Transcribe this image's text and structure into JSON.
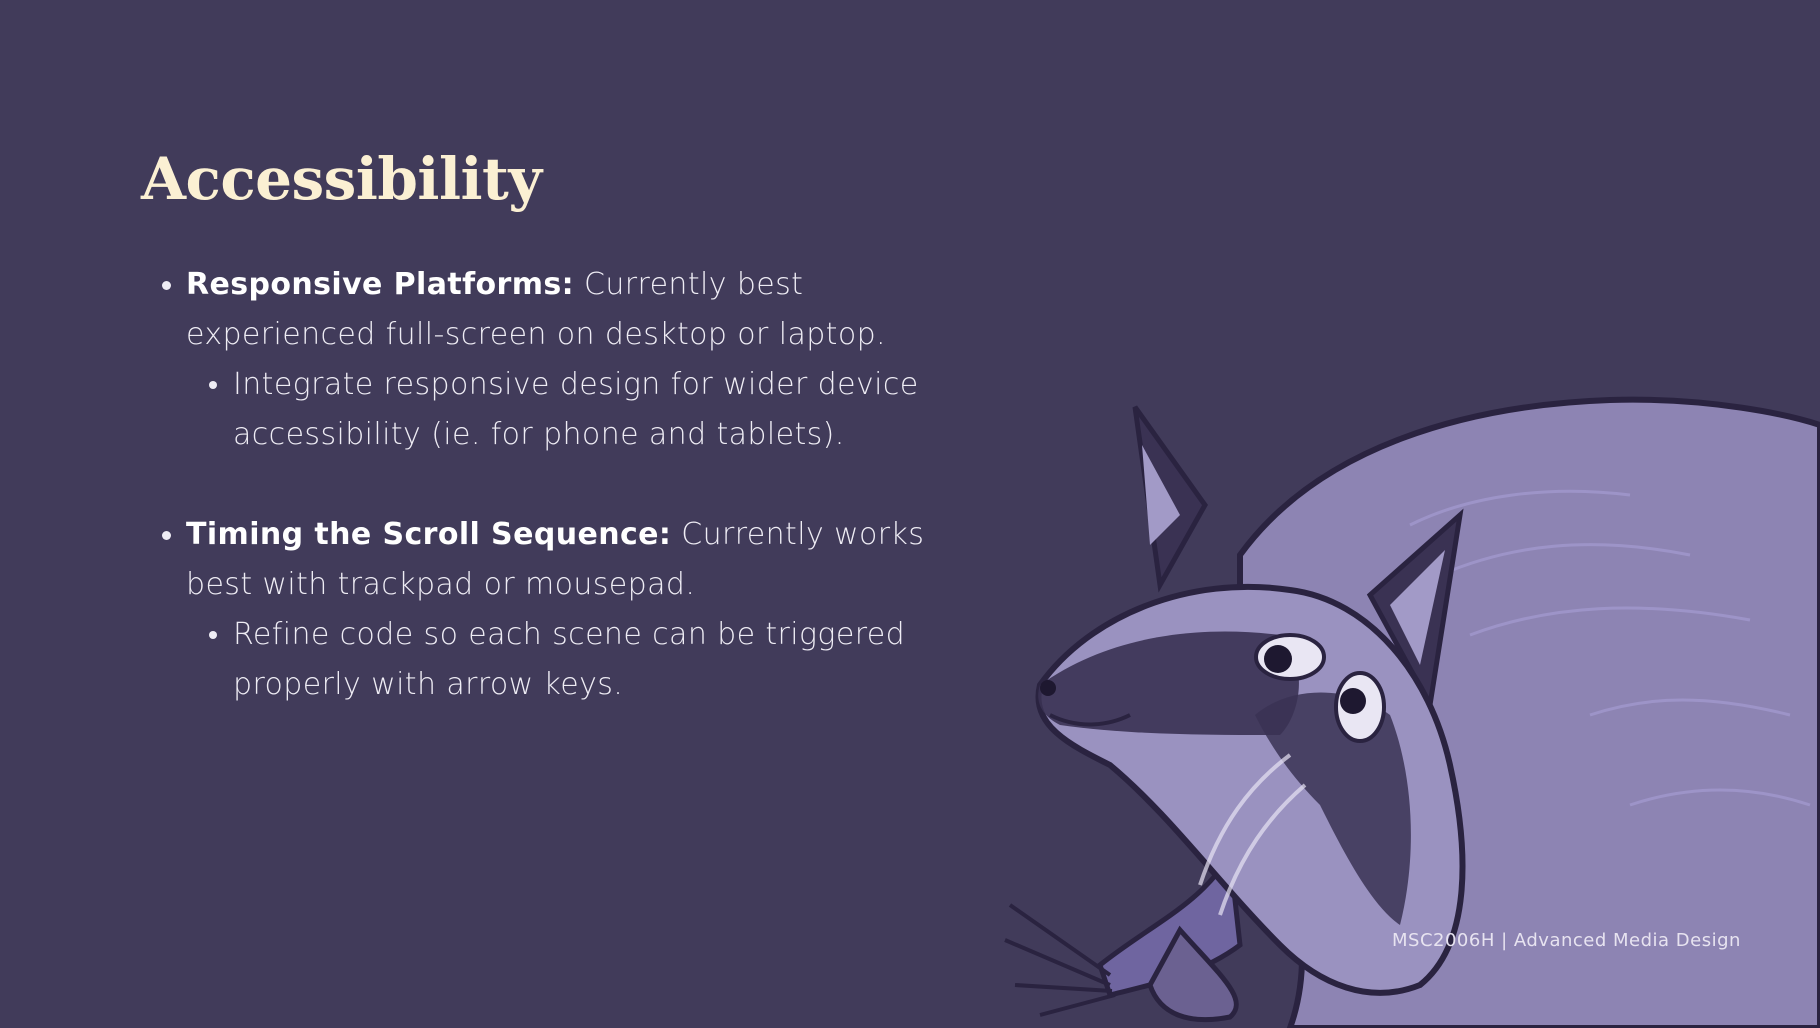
{
  "slide": {
    "title": "Accessibility",
    "bullets": [
      {
        "lead": "Responsive Platforms:",
        "text": " Currently best experienced full-screen on desktop or laptop.",
        "sub": "Integrate responsive design for wider device accessibility (ie. for phone and tablets)."
      },
      {
        "lead": "Timing the Scroll Sequence:",
        "text": " Currently works best with trackpad or mousepad.",
        "sub": "Refine code so each scene can be triggered properly with arrow keys."
      }
    ],
    "footer": "MSC2006H | Advanced Media Design"
  },
  "illustration": {
    "icon": "raccoon-illustration"
  },
  "colors": {
    "background": "#413b5a",
    "title": "#fbf0d3",
    "body_text": "#eeecf4",
    "raccoon_fur": "#8d84b3",
    "raccoon_dark": "#2a2340"
  }
}
